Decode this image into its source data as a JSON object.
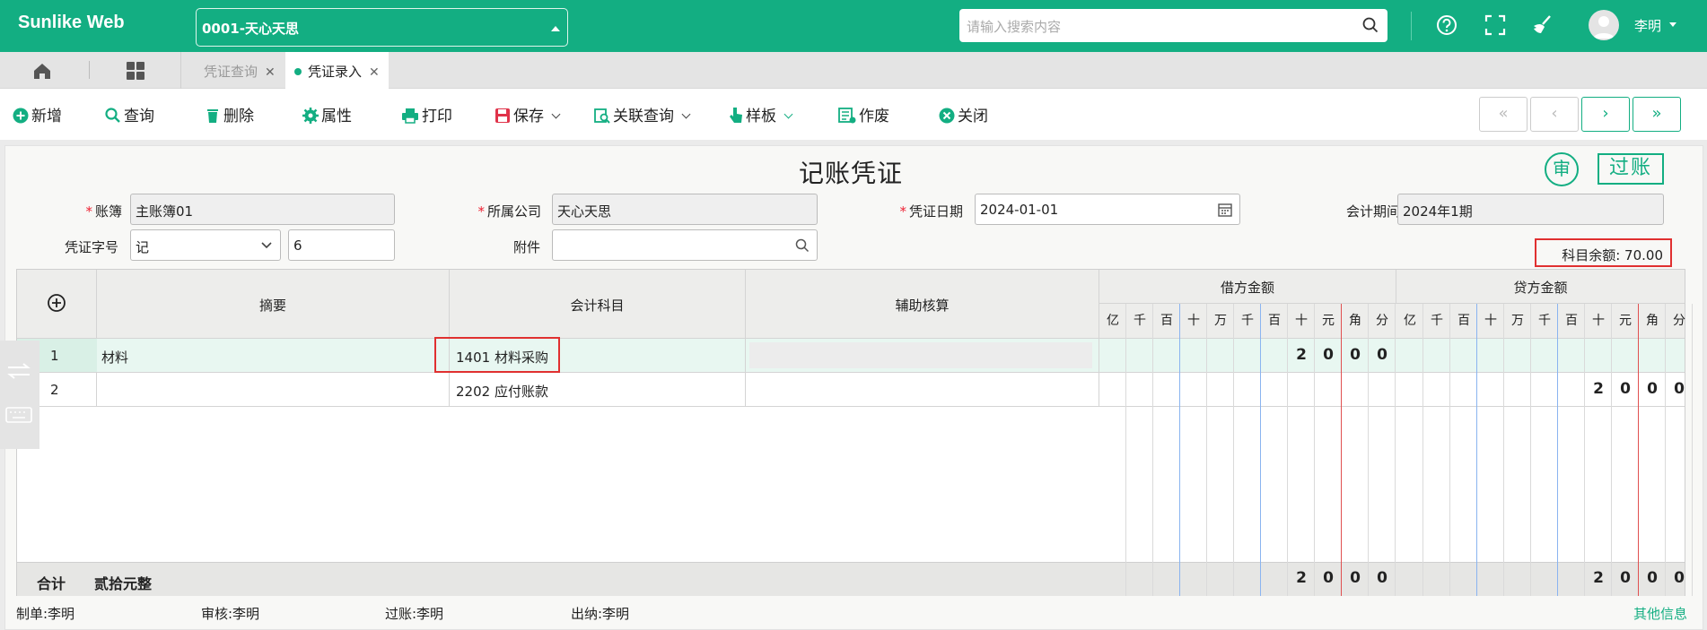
{
  "header": {
    "brand": "Sunlike Web",
    "company_select": "0001-天心天思",
    "search_placeholder": "请输入搜索内容",
    "user_name": "李明"
  },
  "tabs": [
    {
      "label": "凭证查询",
      "active": false
    },
    {
      "label": "凭证录入",
      "active": true
    }
  ],
  "toolbar": {
    "new": "新增",
    "query": "查询",
    "delete": "删除",
    "properties": "属性",
    "print": "打印",
    "save": "保存",
    "linked_query": "关联查询",
    "template": "样板",
    "void": "作废",
    "close": "关闭",
    "nav": [
      "«",
      "‹",
      "›",
      "»"
    ]
  },
  "voucher": {
    "title": "记账凭证",
    "audit_stamp": "审",
    "post_stamp": "过账",
    "ledger_label": "账簿",
    "ledger_value": "主账簿01",
    "company_label": "所属公司",
    "company_value": "天心天思",
    "date_label": "凭证日期",
    "date_value": "2024-01-01",
    "period_label": "会计期间",
    "period_value": "2024年1期",
    "word_label": "凭证字号",
    "word_value": "记",
    "number_value": "6",
    "attachment_label": "附件",
    "attachment_value": "",
    "balance_text": "科目余额:   70.00"
  },
  "grid": {
    "col_summary": "摘要",
    "col_subject": "会计科目",
    "col_aux": "辅助核算",
    "col_debit": "借方金额",
    "col_credit": "贷方金额",
    "digits": [
      "亿",
      "千",
      "百",
      "十",
      "万",
      "千",
      "百",
      "十",
      "元",
      "角",
      "分"
    ],
    "rows": [
      {
        "no": "1",
        "summary": "材料",
        "subject": "1401 材料采购",
        "debit": [
          "2",
          "0",
          "0",
          "0"
        ],
        "credit": []
      },
      {
        "no": "2",
        "summary": "",
        "subject": "2202 应付账款",
        "debit": [],
        "credit": [
          "2",
          "0",
          "0",
          "0"
        ]
      }
    ],
    "total_label": "合计",
    "total_words": "贰拾元整",
    "total_debit": [
      "2",
      "0",
      "0",
      "0"
    ],
    "total_credit": [
      "2",
      "0",
      "0",
      "0"
    ]
  },
  "footer": {
    "maker": "制单:李明",
    "auditor": "审核:李明",
    "poster": "过账:李明",
    "cashier": "出纳:李明",
    "more": "其他信息"
  },
  "colors": {
    "primary": "#13ae82",
    "highlight": "#e03030",
    "selected_row": "#e8f7f1"
  }
}
